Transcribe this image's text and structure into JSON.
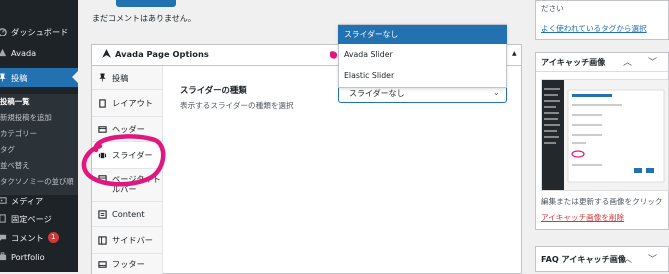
{
  "sidebar": {
    "items": [
      {
        "id": "dashboard",
        "label": "ダッシュボード",
        "icon": "dashboard-icon"
      },
      {
        "id": "avada",
        "label": "Avada",
        "icon": "avada-icon"
      },
      {
        "id": "posts",
        "label": "投稿",
        "icon": "pin-icon",
        "active": true
      },
      {
        "id": "media",
        "label": "メディア",
        "icon": "media-icon"
      },
      {
        "id": "pages",
        "label": "固定ページ",
        "icon": "page-icon"
      },
      {
        "id": "comments",
        "label": "コメント",
        "icon": "comment-icon",
        "badge": "1"
      },
      {
        "id": "portfolio",
        "label": "Portfolio",
        "icon": "portfolio-icon"
      }
    ],
    "sub_items": [
      "投稿一覧",
      "新規投稿を追加",
      "カテゴリー",
      "タグ",
      "並べ替え",
      "タクソノミーの並び順"
    ]
  },
  "top": {
    "no_comments": "まだコメントはありません。"
  },
  "panel": {
    "title": "Avada Page Options",
    "tabs": [
      {
        "label": "投稿",
        "icon": "pin-icon"
      },
      {
        "label": "レイアウト",
        "icon": "document-icon"
      },
      {
        "label": "ヘッダー",
        "icon": "header-icon"
      },
      {
        "label": "スライダー",
        "icon": "slider-icon",
        "selected": true
      },
      {
        "label": "ページタイトルバー",
        "icon": "titlebar-icon"
      },
      {
        "label": "Content",
        "icon": "content-icon"
      },
      {
        "label": "サイドバー",
        "icon": "sidebar-icon"
      },
      {
        "label": "フッター",
        "icon": "footer-icon"
      }
    ],
    "option_label": "スライダーの種類",
    "option_desc": "表示するスライダーの種類を選択",
    "select_value": "スライダーなし",
    "dropdown_options": [
      "スライダーなし",
      "Avada Slider",
      "Elastic Slider"
    ]
  },
  "right": {
    "tag_hint": "ださい",
    "tag_link": "よく使われているタグから選択",
    "featured_title": "アイキャッチ画像",
    "featured_help": "編集または更新する画像をクリック",
    "featured_remove": "アイキャッチ画像を削除",
    "faq_title": "FAQ アイキャッチ画像"
  },
  "colors": {
    "accent": "#2271b1",
    "sidebar_bg": "#1d2327",
    "annotation": "#e0177f",
    "badge": "#d63638"
  }
}
